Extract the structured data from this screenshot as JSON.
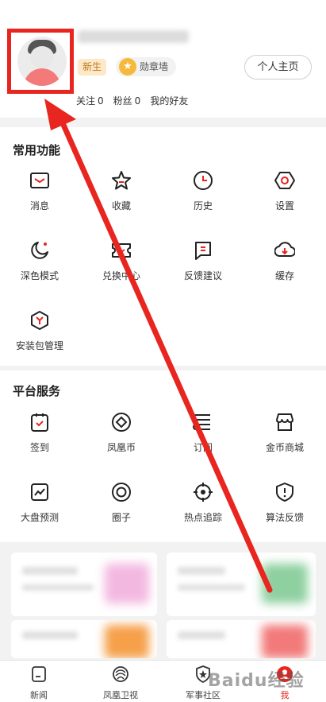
{
  "profile": {
    "badge_new": "新生",
    "badge_medal": "勋章墙",
    "home_button": "个人主页",
    "follow_label": "关注",
    "follow_count": "0",
    "fans_label": "粉丝",
    "fans_count": "0",
    "friends_label": "我的好友"
  },
  "common": {
    "title": "常用功能",
    "items": [
      {
        "label": "消息",
        "icon": "message-icon"
      },
      {
        "label": "收藏",
        "icon": "star-icon"
      },
      {
        "label": "历史",
        "icon": "clock-icon"
      },
      {
        "label": "设置",
        "icon": "settings-icon"
      },
      {
        "label": "深色模式",
        "icon": "moon-icon"
      },
      {
        "label": "兑换中心",
        "icon": "ticket-icon"
      },
      {
        "label": "反馈建议",
        "icon": "feedback-icon"
      },
      {
        "label": "缓存",
        "icon": "cloud-download-icon"
      },
      {
        "label": "安装包管理",
        "icon": "package-icon"
      }
    ]
  },
  "platform": {
    "title": "平台服务",
    "items": [
      {
        "label": "签到",
        "icon": "checkin-icon"
      },
      {
        "label": "凤凰币",
        "icon": "coin-icon"
      },
      {
        "label": "订阅",
        "icon": "subscribe-icon"
      },
      {
        "label": "金币商城",
        "icon": "shop-icon"
      },
      {
        "label": "大盘预测",
        "icon": "chart-icon"
      },
      {
        "label": "圈子",
        "icon": "circle-icon"
      },
      {
        "label": "热点追踪",
        "icon": "target-icon"
      },
      {
        "label": "算法反馈",
        "icon": "shield-alert-icon"
      }
    ]
  },
  "tabs": [
    {
      "label": "新闻",
      "icon": "news-tab-icon"
    },
    {
      "label": "凤凰卫视",
      "icon": "phoenix-tab-icon"
    },
    {
      "label": "军事社区",
      "icon": "military-tab-icon"
    },
    {
      "label": "我",
      "icon": "me-tab-icon",
      "active": true
    }
  ],
  "watermark": "Baidu经验",
  "colors": {
    "accent": "#e8251f",
    "highlight": "#e8251f"
  }
}
